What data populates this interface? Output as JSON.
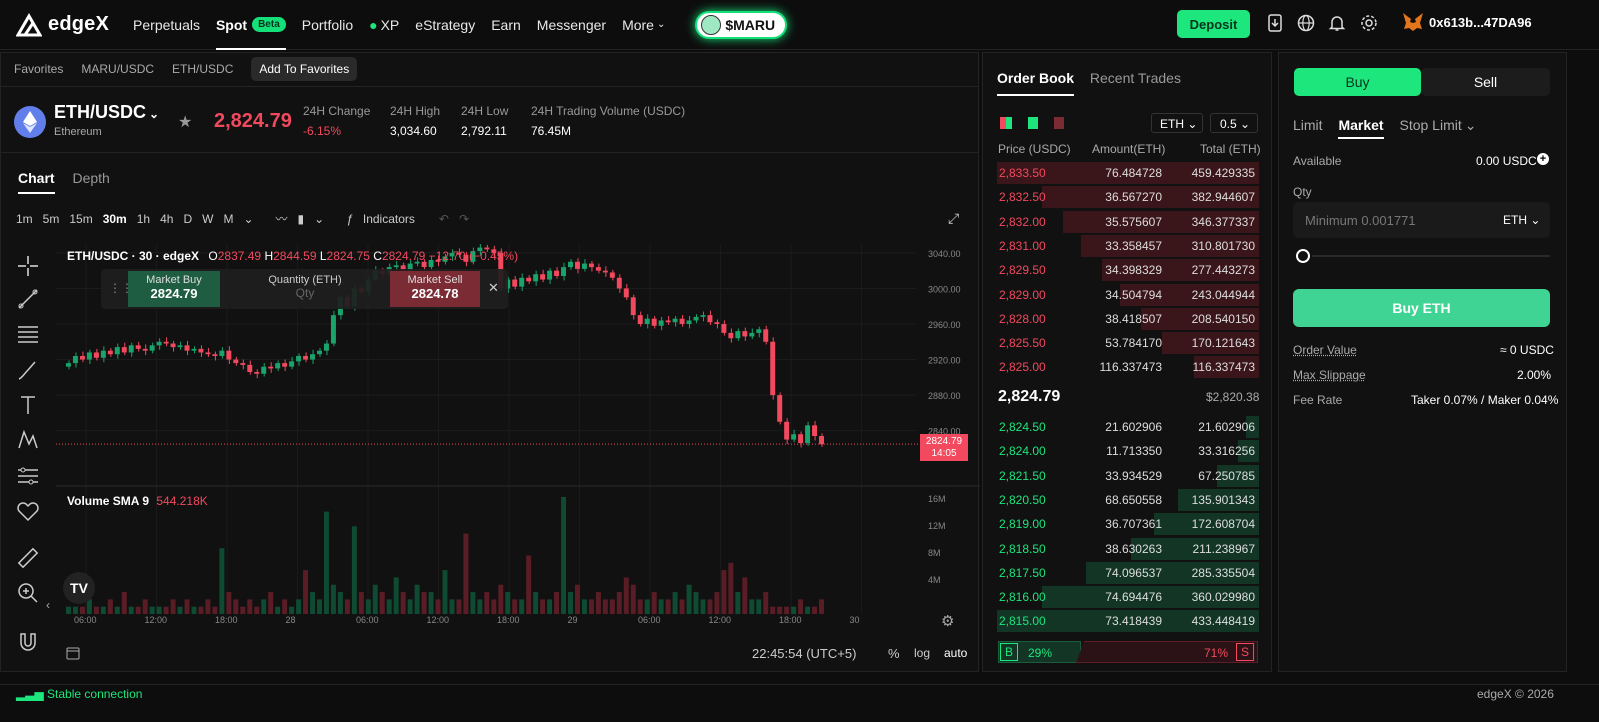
{
  "nav": {
    "logo": "edgeX",
    "items": [
      "Perpetuals",
      "Spot",
      "Portfolio",
      "XP",
      "eStrategy",
      "Earn",
      "Messenger",
      "More"
    ],
    "beta": "Beta",
    "maru": "$MARU",
    "deposit": "Deposit",
    "wallet": "0x613b...47DA96"
  },
  "subnav": {
    "items": [
      "Favorites",
      "MARU/USDC",
      "ETH/USDC"
    ],
    "add_favorites": "Add To Favorites"
  },
  "ticker": {
    "pair": "ETH/USDC",
    "name": "Ethereum",
    "price": "2,824.79",
    "change_label": "24H Change",
    "change": "-6.15%",
    "high_label": "24H High",
    "high": "3,034.60",
    "low_label": "24H Low",
    "low": "2,792.11",
    "vol_label": "24H Trading Volume (USDC)",
    "vol": "76.45M"
  },
  "chart_panel": {
    "tabs": [
      "Chart",
      "Depth"
    ],
    "timeframes": [
      "1m",
      "5m",
      "15m",
      "30m",
      "1h",
      "4h",
      "D",
      "W",
      "M"
    ],
    "indicators": "Indicators",
    "legend_title": "ETH/USDC · 30 · edgeX",
    "ohlc": {
      "o_label": "O",
      "o": "2837.49",
      "h_label": "H",
      "h": "2844.59",
      "l_label": "L",
      "l": "2824.75",
      "c_label": "C",
      "c": "2824.79",
      "chg": "−12.70 (−0.45%)"
    },
    "quick_trade": {
      "buy_label": "Market Buy",
      "buy_price": "2824.79",
      "qty_label": "Quantity (ETH)",
      "qty_placeholder": "Qty",
      "sell_label": "Market Sell",
      "sell_price": "2824.78"
    },
    "volume_label": "Volume SMA 9",
    "volume_value": "544.218K",
    "price_tag": "2824.79",
    "price_tag_time": "14:05",
    "time": "22:45:54 (UTC+5)",
    "scale_opts": [
      "%",
      "log",
      "auto"
    ]
  },
  "chart_data": {
    "type": "candlestick",
    "y_ticks": [
      "3040.00",
      "3000.00",
      "2960.00",
      "2920.00",
      "2880.00",
      "2840.00"
    ],
    "y_range": [
      2780,
      3050
    ],
    "vol_ticks": [
      "16M",
      "12M",
      "8M",
      "4M"
    ],
    "x_ticks": [
      "06:00",
      "12:00",
      "18:00",
      "28",
      "06:00",
      "12:00",
      "18:00",
      "29",
      "06:00",
      "12:00",
      "18:00",
      "30"
    ],
    "closes": [
      2916,
      2924,
      2920,
      2928,
      2922,
      2930,
      2926,
      2934,
      2928,
      2936,
      2932,
      2930,
      2936,
      2940,
      2938,
      2934,
      2936,
      2930,
      2932,
      2928,
      2926,
      2924,
      2930,
      2920,
      2916,
      2914,
      2906,
      2904,
      2912,
      2910,
      2916,
      2912,
      2918,
      2924,
      2920,
      2926,
      2930,
      2938,
      2970,
      2990,
      2980,
      3000,
      2996,
      3010,
      3020,
      3016,
      3024,
      3026,
      3018,
      3028,
      3030,
      3024,
      3032,
      3030,
      3036,
      3040,
      3038,
      3030,
      3042,
      3046,
      3044,
      3040,
      3000,
      3010,
      3002,
      3012,
      3008,
      3016,
      3010,
      3020,
      3014,
      3024,
      3030,
      3022,
      3028,
      3024,
      3020,
      3018,
      3012,
      3000,
      2990,
      2970,
      2960,
      2966,
      2958,
      2964,
      2962,
      2966,
      2960,
      2964,
      2968,
      2970,
      2962,
      2960,
      2950,
      2944,
      2952,
      2946,
      2950,
      2954,
      2940,
      2880,
      2850,
      2830,
      2836,
      2826,
      2846,
      2834,
      2824.79
    ],
    "volumes": [
      1,
      1,
      1,
      2,
      1,
      1,
      2,
      1,
      3,
      1,
      1,
      2,
      1,
      1,
      1,
      2,
      1,
      2,
      1,
      1,
      2,
      1,
      9,
      3,
      2,
      1,
      2,
      1,
      2,
      3,
      1,
      2,
      1,
      2,
      6,
      3,
      2,
      14,
      4,
      3,
      2,
      12,
      3,
      2,
      4,
      3,
      2,
      5,
      3,
      2,
      4,
      3,
      3,
      2,
      6,
      2,
      2,
      11,
      3,
      2,
      3,
      2,
      4,
      3,
      2,
      2,
      8,
      3,
      2,
      2,
      3,
      16,
      3,
      4,
      2,
      2,
      3,
      2,
      2,
      3,
      5,
      4,
      2,
      2,
      3,
      2,
      2,
      3,
      2,
      4,
      3,
      2,
      2,
      3,
      6,
      7,
      3,
      5,
      2,
      2,
      3,
      1
    ]
  },
  "orderbook": {
    "tabs": [
      "Order Book",
      "Recent Trades"
    ],
    "asset": "ETH",
    "step": "0.5",
    "headers": [
      "Price (USDC)",
      "Amount(ETH)",
      "Total (ETH)"
    ],
    "asks": [
      {
        "p": "2,833.50",
        "a": "76.484728",
        "t": "459.429335",
        "f": 1.0
      },
      {
        "p": "2,832.50",
        "a": "36.567270",
        "t": "382.944607",
        "f": 0.83
      },
      {
        "p": "2,832.00",
        "a": "35.575607",
        "t": "346.377337",
        "f": 0.75
      },
      {
        "p": "2,831.00",
        "a": "33.358457",
        "t": "310.801730",
        "f": 0.68
      },
      {
        "p": "2,829.50",
        "a": "34.398329",
        "t": "277.443273",
        "f": 0.6
      },
      {
        "p": "2,829.00",
        "a": "34.504794",
        "t": "243.044944",
        "f": 0.53
      },
      {
        "p": "2,828.00",
        "a": "38.418507",
        "t": "208.540150",
        "f": 0.45
      },
      {
        "p": "2,825.50",
        "a": "53.784170",
        "t": "170.121643",
        "f": 0.37
      },
      {
        "p": "2,825.00",
        "a": "116.337473",
        "t": "116.337473",
        "f": 0.25
      }
    ],
    "mid": "2,824.79",
    "index": "$2,820.38",
    "bids": [
      {
        "p": "2,824.50",
        "a": "21.602906",
        "t": "21.602906",
        "f": 0.05
      },
      {
        "p": "2,824.00",
        "a": "11.713350",
        "t": "33.316256",
        "f": 0.08
      },
      {
        "p": "2,821.50",
        "a": "33.934529",
        "t": "67.250785",
        "f": 0.16
      },
      {
        "p": "2,820.50",
        "a": "68.650558",
        "t": "135.901343",
        "f": 0.31
      },
      {
        "p": "2,819.00",
        "a": "36.707361",
        "t": "172.608704",
        "f": 0.4
      },
      {
        "p": "2,818.50",
        "a": "38.630263",
        "t": "211.238967",
        "f": 0.49
      },
      {
        "p": "2,817.50",
        "a": "74.096537",
        "t": "285.335504",
        "f": 0.66
      },
      {
        "p": "2,816.00",
        "a": "74.694476",
        "t": "360.029980",
        "f": 0.83
      },
      {
        "p": "2,815.00",
        "a": "73.418439",
        "t": "433.448419",
        "f": 1.0
      }
    ],
    "ratio": {
      "b": "B",
      "b_pct": "29%",
      "s_pct": "71%",
      "s": "S",
      "b_frac": 0.29
    }
  },
  "order_form": {
    "buy": "Buy",
    "sell": "Sell",
    "types": [
      "Limit",
      "Market",
      "Stop Limit"
    ],
    "available_label": "Available",
    "available": "0.00 USDC",
    "qty_label": "Qty",
    "qty_placeholder": "Minimum 0.001771",
    "qty_unit": "ETH",
    "submit": "Buy ETH",
    "order_value_label": "Order Value",
    "order_value": "≈ 0 USDC",
    "slippage_label": "Max Slippage",
    "slippage": "2.00%",
    "fee_label": "Fee Rate",
    "fee": "Taker 0.07% / Maker 0.04%"
  },
  "footer": {
    "status": "Stable connection",
    "copyright": "edgeX © 2026"
  }
}
